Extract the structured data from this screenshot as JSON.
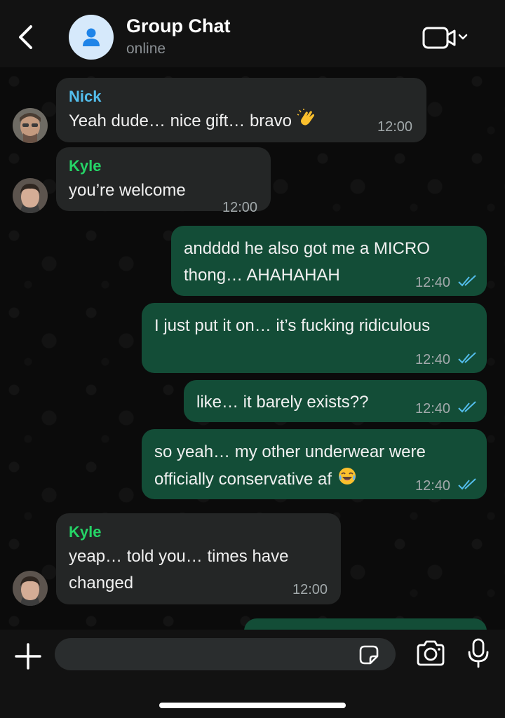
{
  "header": {
    "title": "Group Chat",
    "status": "online",
    "icons": {
      "back": "chevron-left-icon",
      "avatar": "person-icon",
      "video": "video-call-icon"
    }
  },
  "messages": [
    {
      "direction": "incoming",
      "sender": "Nick",
      "sender_color": "#53bdeb",
      "lines": [
        "Yeah dude… nice gift… bravo"
      ],
      "emoji": "clapping-hands",
      "time": "12:00",
      "avatar": true
    },
    {
      "direction": "incoming",
      "sender": "Kyle",
      "sender_color": "#25d366",
      "lines": [
        "you’re welcome"
      ],
      "time": "12:00",
      "avatar": true
    },
    {
      "direction": "outgoing",
      "lines": [
        "andddd he also got me a MICRO",
        "thong… AHAHAHAH"
      ],
      "time": "12:40",
      "read": true
    },
    {
      "direction": "outgoing",
      "lines": [
        "I just put it on… it’s fucking ridiculous"
      ],
      "time": "12:40",
      "read": true
    },
    {
      "direction": "outgoing",
      "lines": [
        "like… it barely exists??"
      ],
      "time": "12:40",
      "read": true
    },
    {
      "direction": "outgoing",
      "lines": [
        "so yeah… my other underwear were",
        "officially conservative af"
      ],
      "emoji": "laughing-tears",
      "time": "12:40",
      "read": true
    },
    {
      "direction": "incoming",
      "sender": "Kyle",
      "sender_color": "#25d366",
      "lines": [
        "yeap… told you… times have",
        "changed"
      ],
      "time": "12:00",
      "avatar": true
    },
    {
      "direction": "outgoing",
      "lines": [],
      "partial": true
    }
  ],
  "footer": {
    "input_value": "",
    "icons": {
      "plus": "plus-icon",
      "sticker": "sticker-icon",
      "camera": "camera-icon",
      "mic": "microphone-icon"
    }
  },
  "colors": {
    "incoming_bubble": "#242626",
    "outgoing_bubble": "#134d37",
    "read_ticks": "#53bdeb"
  }
}
